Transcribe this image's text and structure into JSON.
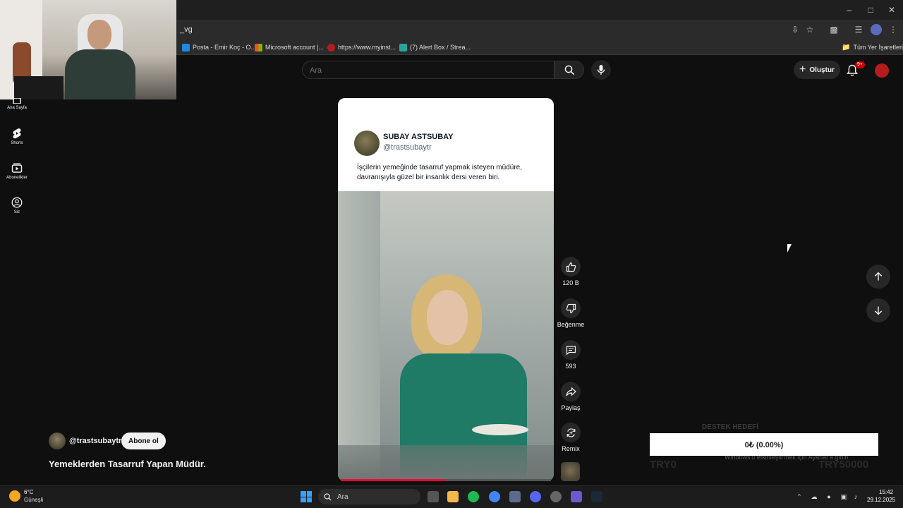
{
  "browser": {
    "url_fragment": "_vg",
    "bookmarks": [
      {
        "label": "Posta - Emir Koç - O...",
        "color": "#1e88e5"
      },
      {
        "label": "Microsoft account |...",
        "color": "#f25022"
      },
      {
        "label": "https://www.myinst...",
        "color": "#b71c1c"
      },
      {
        "label": "(7) Alert Box / Strea...",
        "color": "#26a69a"
      }
    ],
    "all_bookmarks_label": "Tüm Yer İşaretleri"
  },
  "header": {
    "search_placeholder": "Ara",
    "create_label": "Oluştur",
    "notification_badge": "9+"
  },
  "sidebar": {
    "items": [
      {
        "label": "Ana Sayfa",
        "icon": "home-icon"
      },
      {
        "label": "Shorts",
        "icon": "shorts-icon"
      },
      {
        "label": "Abonelikler",
        "icon": "subscriptions-icon"
      },
      {
        "label": "Siz",
        "icon": "profile-icon"
      }
    ]
  },
  "short": {
    "tweet": {
      "name": "SUBAY ASTSUBAY",
      "handle": "@trastsubaytr",
      "text": "İşçilerin yemeğinde tasarruf yapmak isteyen müdüre, davranışıyla güzel bir insanlık dersi veren biri."
    },
    "progress": 0.5,
    "actions": {
      "like_count": "120 B",
      "dislike_label": "Beğenme",
      "comment_count": "593",
      "share_label": "Paylaş",
      "remix_label": "Remix"
    },
    "channel": "@trastsubaytr",
    "subscribe_label": "Abone ol",
    "title": "Yemeklerden Tasarruf Yapan Müdür."
  },
  "donation": {
    "heading": "DESTEK HEDEFİ",
    "progress_text": "0₺ (0.00%)",
    "min_label": "TRY0",
    "max_label": "TRY50000"
  },
  "watermark": "Windows'u etkinleştirmek için Ayarlar'a gidin.",
  "taskbar": {
    "weather_temp": "6°C",
    "weather_cond": "Güneşli",
    "search_placeholder": "Ara",
    "time": "15:42",
    "date": "29.12.2025"
  }
}
